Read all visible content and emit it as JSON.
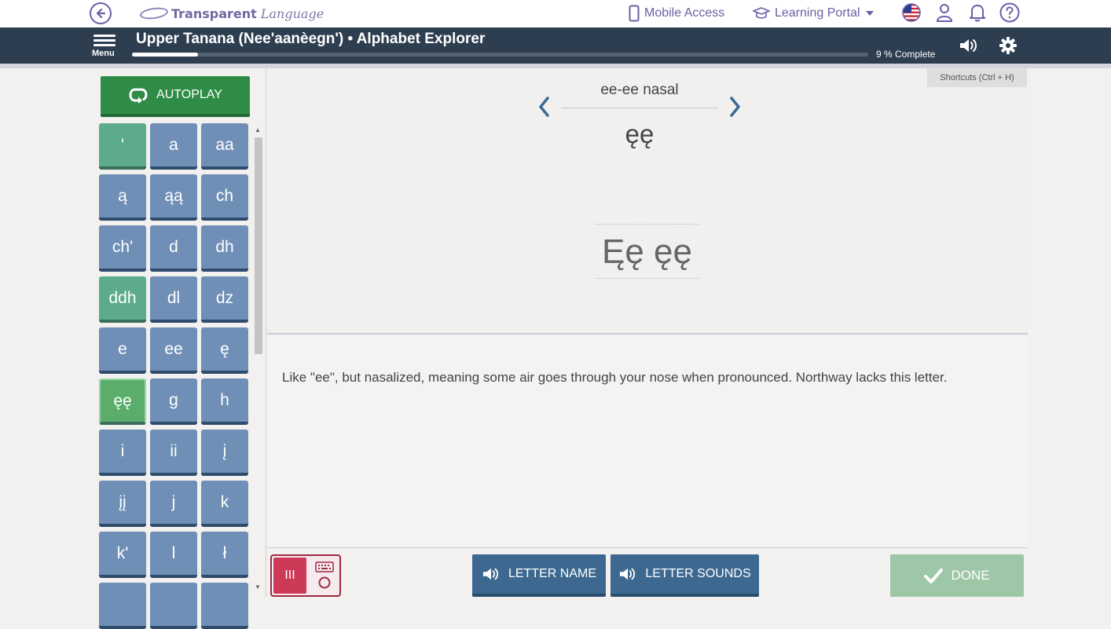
{
  "topbar": {
    "logo_brand": "Transparent",
    "logo_word": "Language",
    "mobile_access": "Mobile Access",
    "learning_portal": "Learning Portal"
  },
  "header": {
    "menu_label": "Menu",
    "title": "Upper Tanana (Nee'aanèegn') • Alphabet Explorer",
    "progress_percent": 9,
    "progress_label": "9 % Complete"
  },
  "sidebar": {
    "autoplay_label": "AUTOPLAY",
    "letters": [
      "'",
      "a",
      "aa",
      "ą",
      "ąą",
      "ch",
      "ch'",
      "d",
      "dh",
      "ddh",
      "dl",
      "dz",
      "e",
      "ee",
      "ę",
      "ęę",
      "g",
      "h",
      "i",
      "ii",
      "į",
      "įį",
      "j",
      "k",
      "k'",
      "l",
      "ł"
    ],
    "green_letters": [
      "'",
      "ddh"
    ],
    "active_letter": "ęę"
  },
  "main": {
    "shortcuts": "Shortcuts  (Ctrl + H)",
    "letter_name": "ee-ee nasal",
    "letter_small": "ęę",
    "letter_big": "Ęę  ęę",
    "description": "Like \"ee\", but nasalized, meaning some air goes through your nose when pronounced. Northway lacks this letter."
  },
  "controls": {
    "mode_left": "III",
    "letter_name_btn": "LETTER NAME",
    "letter_sounds_btn": "LETTER SOUNDS",
    "done_btn": "DONE"
  },
  "colors": {
    "accent_purple": "#6a5fa8",
    "header_navy": "#2d3e50",
    "tile_blue": "#6f8fb6",
    "tile_green": "#5cab8c",
    "autoplay_green": "#2f8c46",
    "button_blue": "#3d6991",
    "done_green": "#9ec7a8",
    "mode_red": "#cd3a58"
  }
}
